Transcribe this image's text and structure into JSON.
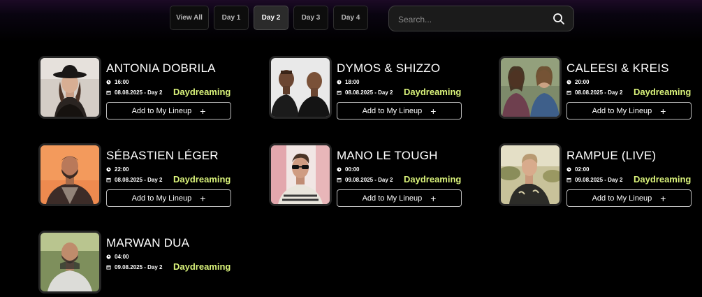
{
  "tabs": [
    {
      "label": "View All",
      "active": false
    },
    {
      "label": "Day 1",
      "active": false
    },
    {
      "label": "Day 2",
      "active": true
    },
    {
      "label": "Day 3",
      "active": false
    },
    {
      "label": "Day 4",
      "active": false
    }
  ],
  "search": {
    "placeholder": "Search..."
  },
  "button_label": "Add to My Lineup",
  "button_icon": "plus-icon",
  "accent_color": "#d9f27a",
  "artists": [
    {
      "name": "ANTONIA DOBRILA",
      "time": "16:00",
      "date": "08.08.2025 - Day 2",
      "stage": "Daydreaming"
    },
    {
      "name": "DYMOS & SHIZZO",
      "time": "18:00",
      "date": "08.08.2025 - Day 2",
      "stage": "Daydreaming"
    },
    {
      "name": "CALEESI & KREIS",
      "time": "20:00",
      "date": "08.08.2025 - Day 2",
      "stage": "Daydreaming"
    },
    {
      "name": "SÉBASTIEN LÉGER",
      "time": "22:00",
      "date": "08.08.2025 - Day 2",
      "stage": "Daydreaming"
    },
    {
      "name": "MANO LE TOUGH",
      "time": "00:00",
      "date": "09.08.2025 - Day 2",
      "stage": "Daydreaming"
    },
    {
      "name": "RAMPUE (LIVE)",
      "time": "02:00",
      "date": "09.08.2025 - Day 2",
      "stage": "Daydreaming"
    },
    {
      "name": "MARWAN DUA",
      "time": "04:00",
      "date": "09.08.2025 - Day 2",
      "stage": "Daydreaming"
    }
  ]
}
